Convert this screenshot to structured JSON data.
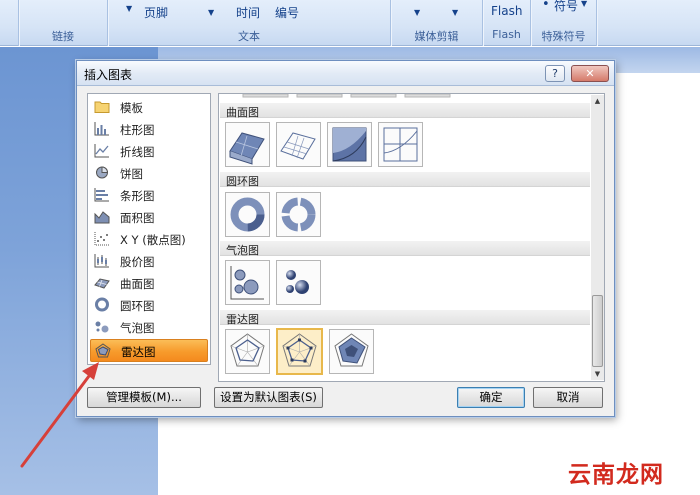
{
  "ribbon": {
    "fragments": {
      "footer": "页脚",
      "time": "时间",
      "number": "编号",
      "flash": "Flash",
      "symbol": "符号"
    },
    "groups": {
      "links": "链接",
      "text": "文本",
      "media_clip": "媒体剪辑",
      "flash": "Flash",
      "special_symbols": "特殊符号"
    }
  },
  "dialog": {
    "title": "插入图表",
    "help_btn": "?",
    "close_btn": "✕",
    "categories": [
      {
        "label": "模板",
        "icon": "folder-icon"
      },
      {
        "label": "柱形图",
        "icon": "column-chart-icon"
      },
      {
        "label": "折线图",
        "icon": "line-chart-icon"
      },
      {
        "label": "饼图",
        "icon": "pie-chart-icon"
      },
      {
        "label": "条形图",
        "icon": "bar-chart-icon"
      },
      {
        "label": "面积图",
        "icon": "area-chart-icon"
      },
      {
        "label": "X Y (散点图)",
        "icon": "scatter-chart-icon"
      },
      {
        "label": "股价图",
        "icon": "stock-chart-icon"
      },
      {
        "label": "曲面图",
        "icon": "surface-chart-icon"
      },
      {
        "label": "圆环图",
        "icon": "doughnut-chart-icon"
      },
      {
        "label": "气泡图",
        "icon": "bubble-chart-icon"
      },
      {
        "label": "雷达图",
        "icon": "radar-chart-icon",
        "selected": true
      }
    ],
    "sections": {
      "surface": {
        "label": "曲面图",
        "thumbs": [
          "3d-surface-icon",
          "wireframe-3d-surface-icon",
          "contour-icon",
          "wireframe-contour-icon"
        ]
      },
      "doughnut": {
        "label": "圆环图",
        "thumbs": [
          "doughnut-icon",
          "exploded-doughnut-icon"
        ]
      },
      "bubble": {
        "label": "气泡图",
        "thumbs": [
          "bubble-icon",
          "3d-bubble-icon"
        ]
      },
      "radar": {
        "label": "雷达图",
        "thumbs": [
          "radar-icon",
          "radar-with-markers-icon",
          "filled-radar-icon"
        ],
        "selected_index": 1
      }
    },
    "buttons": {
      "manage_templates": "管理模板(M)...",
      "set_default": "设置为默认图表(S)",
      "ok": "确定",
      "cancel": "取消"
    }
  },
  "watermark": "云南龙网",
  "colors": {
    "selection_orange": "#f79b2c",
    "ribbon_blue": "#d6e4f6",
    "annotation_red": "#d6403a",
    "watermark_red": "#d22a1e"
  }
}
